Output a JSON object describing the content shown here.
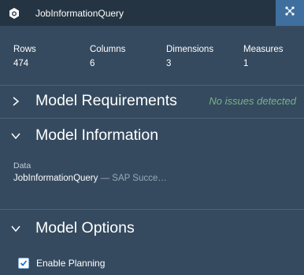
{
  "header": {
    "title": "JobInformationQuery",
    "logo_icon": "cube-icon",
    "action_icon": "network-icon"
  },
  "stats": [
    {
      "label": "Rows",
      "value": "474"
    },
    {
      "label": "Columns",
      "value": "6"
    },
    {
      "label": "Dimensions",
      "value": "3"
    },
    {
      "label": "Measures",
      "value": "1"
    }
  ],
  "sections": {
    "requirements": {
      "title": "Model Requirements",
      "status": "No issues detected",
      "expanded": false
    },
    "information": {
      "title": "Model Information",
      "expanded": true,
      "data_label": "Data",
      "data_name": "JobInformationQuery",
      "data_source": " — SAP Succe…"
    },
    "options": {
      "title": "Model Options",
      "expanded": true,
      "enable_planning_label": "Enable Planning",
      "enable_planning_checked": true
    }
  },
  "colors": {
    "header_bg": "#243443",
    "panel_bg": "#354a5f",
    "accent": "#3f6f9e",
    "status_ok": "#78b28a"
  }
}
